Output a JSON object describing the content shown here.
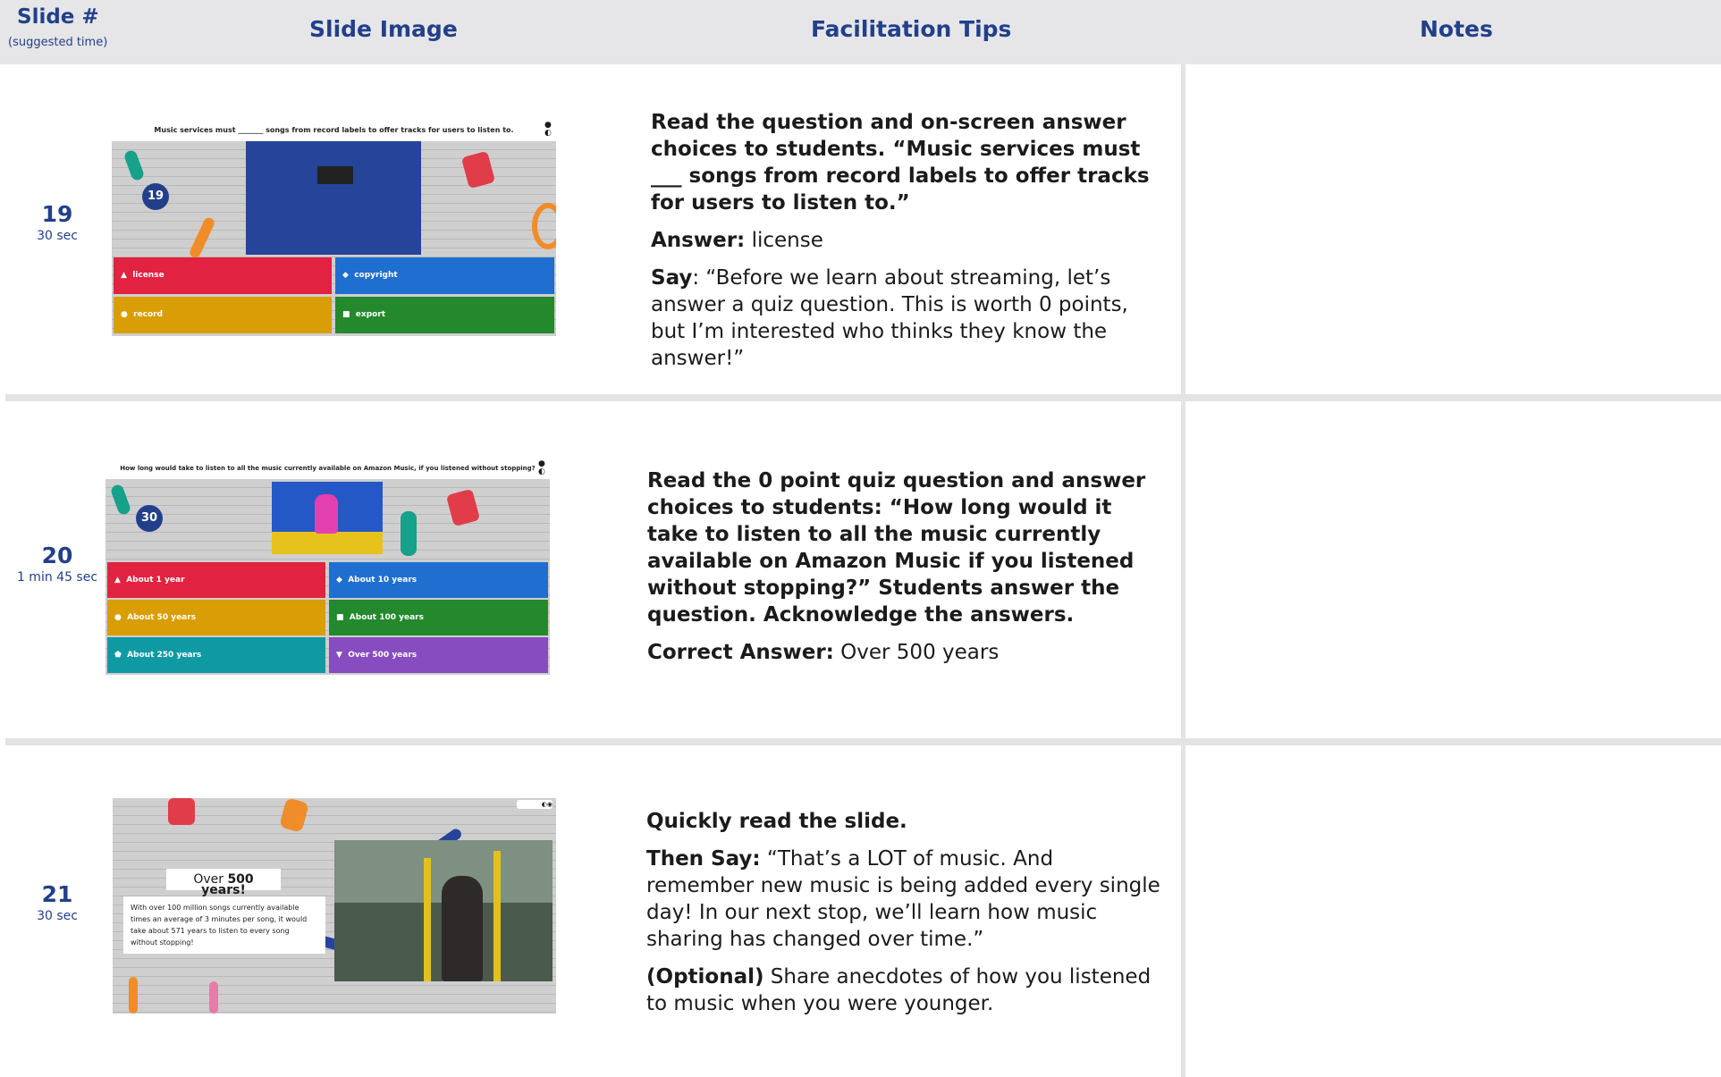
{
  "header": {
    "slide_label": "Slide #",
    "slide_sub": "(suggested time)",
    "image_label": "Slide Image",
    "tips_label": "Facilitation Tips",
    "notes_label": "Notes"
  },
  "rows": [
    {
      "number": "19",
      "time": "30 sec",
      "slide": {
        "question": "Music services must _______ songs from record labels to offer tracks for users to listen to.",
        "timer": "19",
        "options": [
          "license",
          "copyright",
          "record",
          "export"
        ]
      },
      "tips": {
        "p1": "Read the question and on-screen answer choices to students. “Music services must ___ songs from record labels to offer tracks for users to listen to.”",
        "answer_label": "Answer:",
        "answer_value": " license",
        "say_label": "Say",
        "say_text": ": “Before we learn about streaming, let’s answer a quiz question. This is worth 0 points, but I’m interested who thinks they know the answer!”"
      }
    },
    {
      "number": "20",
      "time": "1 min 45 sec",
      "slide": {
        "question": "How long would take to listen to all the music currently available on Amazon Music, if you listened without stopping?",
        "timer": "30",
        "options": [
          "About 1 year",
          "About 10 years",
          "About 50 years",
          "About 100 years",
          "About 250 years",
          "Over 500 years"
        ]
      },
      "tips": {
        "p1": "Read the 0 point quiz question and answer choices to students: “How long would it take to listen to all the music currently available on Amazon Music if you listened without stopping?” Students answer the question. Acknowledge the answers.",
        "answer_label": "Correct Answer:",
        "answer_value": " Over 500 years"
      }
    },
    {
      "number": "21",
      "time": "30 sec",
      "slide": {
        "heading_prefix": "Over ",
        "heading_bold": "500 years!",
        "body": "With over 100 million songs currently available times an average of 3 minutes per song, it would take about 571 years to listen to every song without stopping!"
      },
      "tips": {
        "p1": "Quickly read the slide.",
        "say_label": "Then Say:",
        "say_text": " “That’s a LOT of music. And remember new music is being added every single day! In our next stop, we’ll learn how music sharing has changed over time.”",
        "opt_label": "(Optional)",
        "opt_text": " Share anecdotes of how you listened to music when you were younger."
      }
    }
  ]
}
